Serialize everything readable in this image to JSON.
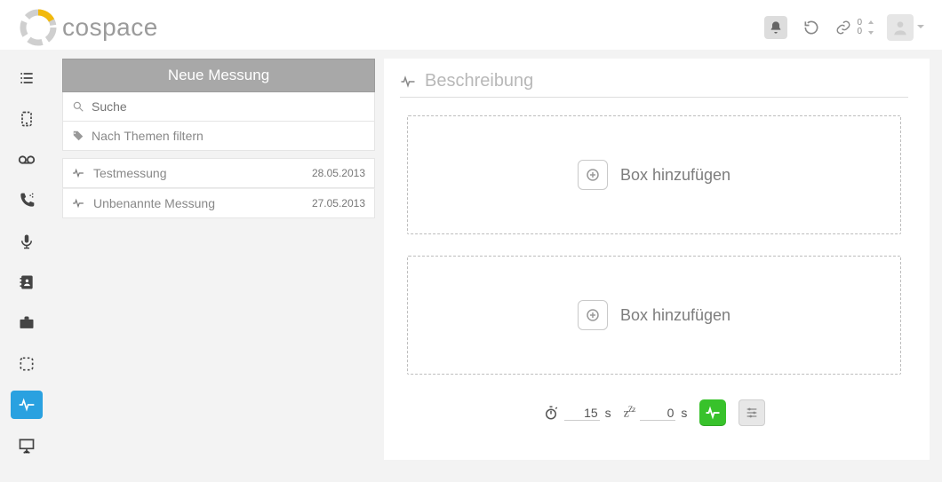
{
  "brand": {
    "name": "cospace"
  },
  "header": {
    "link_counts": {
      "top": "0",
      "bottom": "0"
    }
  },
  "list": {
    "new_button": "Neue Messung",
    "search_placeholder": "Suche",
    "filter_label": "Nach Themen filtern",
    "items": [
      {
        "title": "Testmessung",
        "date": "28.05.2013"
      },
      {
        "title": "Unbenannte Messung",
        "date": "27.05.2013"
      }
    ]
  },
  "detail": {
    "title_placeholder": "Beschreibung",
    "add_box_label": "Box hinzufügen",
    "timer_value": "15",
    "timer_unit": "s",
    "sleep_value": "0",
    "sleep_unit": "s"
  }
}
